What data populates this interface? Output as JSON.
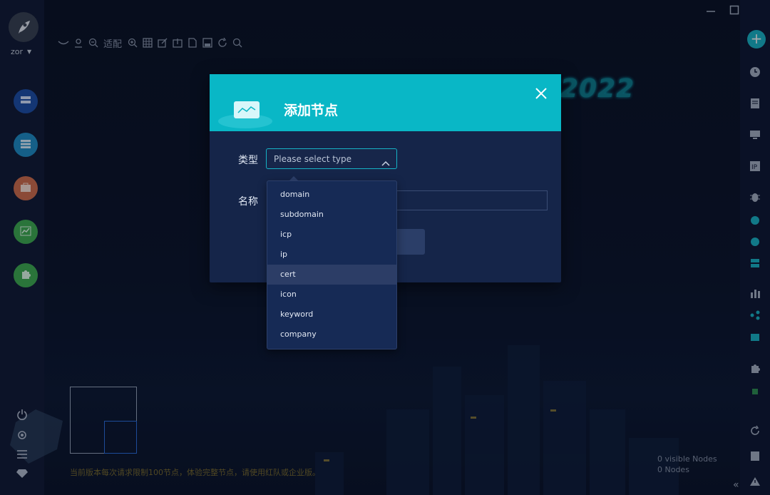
{
  "app": {
    "username": "zor",
    "background_year": "2022"
  },
  "toolbar": {
    "fit_label": "适配"
  },
  "footer": {
    "notice": "当前版本每次请求限制100节点，体验完整节点，请使用红队或企业版。",
    "visible_nodes": "0 visible Nodes",
    "nodes": "0 Nodes"
  },
  "modal": {
    "title": "添加节点",
    "type_label": "类型",
    "name_label": "名称",
    "type_placeholder": "Please select type",
    "options": [
      "domain",
      "subdomain",
      "icp",
      "ip",
      "cert",
      "icon",
      "keyword",
      "company"
    ],
    "hovered_option": "cert"
  },
  "colors": {
    "accent": "#09b7c6",
    "modal_bg": "#152549",
    "sidebar_bg": "#121a33"
  }
}
